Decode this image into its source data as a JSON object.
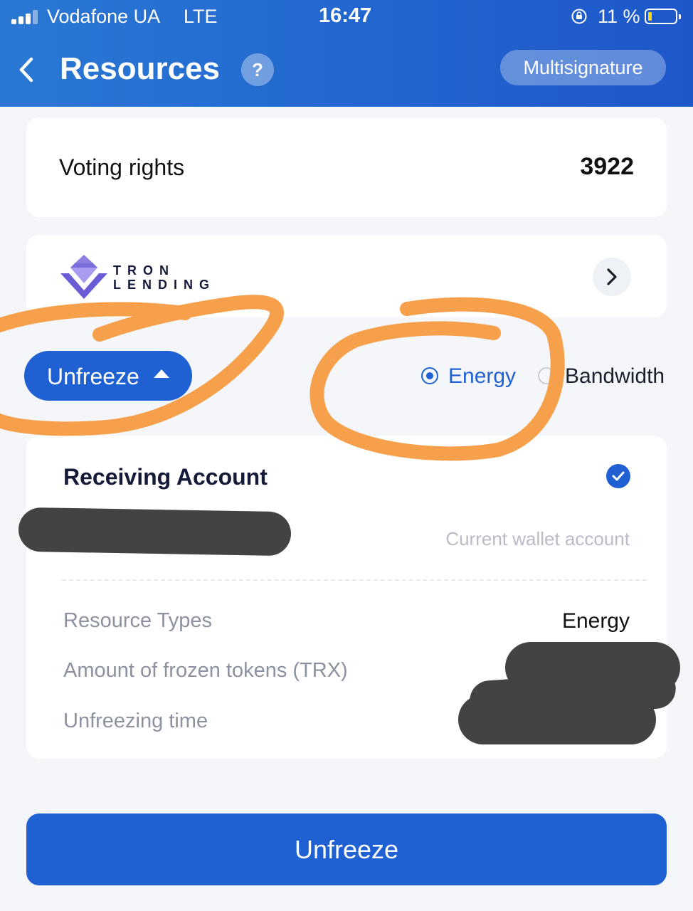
{
  "status_bar": {
    "carrier": "Vodafone UA",
    "network": "LTE",
    "time": "16:47",
    "battery_percent": "11 %"
  },
  "header": {
    "title": "Resources",
    "help_label": "?",
    "multisig_label": "Multisignature"
  },
  "voting": {
    "label": "Voting rights",
    "value": "3922"
  },
  "tron_lending": {
    "line1": "TRON",
    "line2": "LENDING"
  },
  "mode": {
    "toggle_label": "Unfreeze",
    "resource_options": [
      "Energy",
      "Bandwidth"
    ],
    "selected": "Energy"
  },
  "details": {
    "receiving_title": "Receiving Account",
    "wallet_hint": "Current wallet account",
    "rows": [
      {
        "label": "Resource Types",
        "value": "Energy"
      },
      {
        "label": "Amount of frozen tokens (TRX)",
        "value": ""
      },
      {
        "label": "Unfreezing time",
        "value": ""
      }
    ]
  },
  "submit_label": "Unfreeze",
  "colors": {
    "header_blue": "#2266cf",
    "primary_blue": "#1f60d3",
    "annotation_orange": "#f7a04c",
    "redaction": "#434343"
  }
}
